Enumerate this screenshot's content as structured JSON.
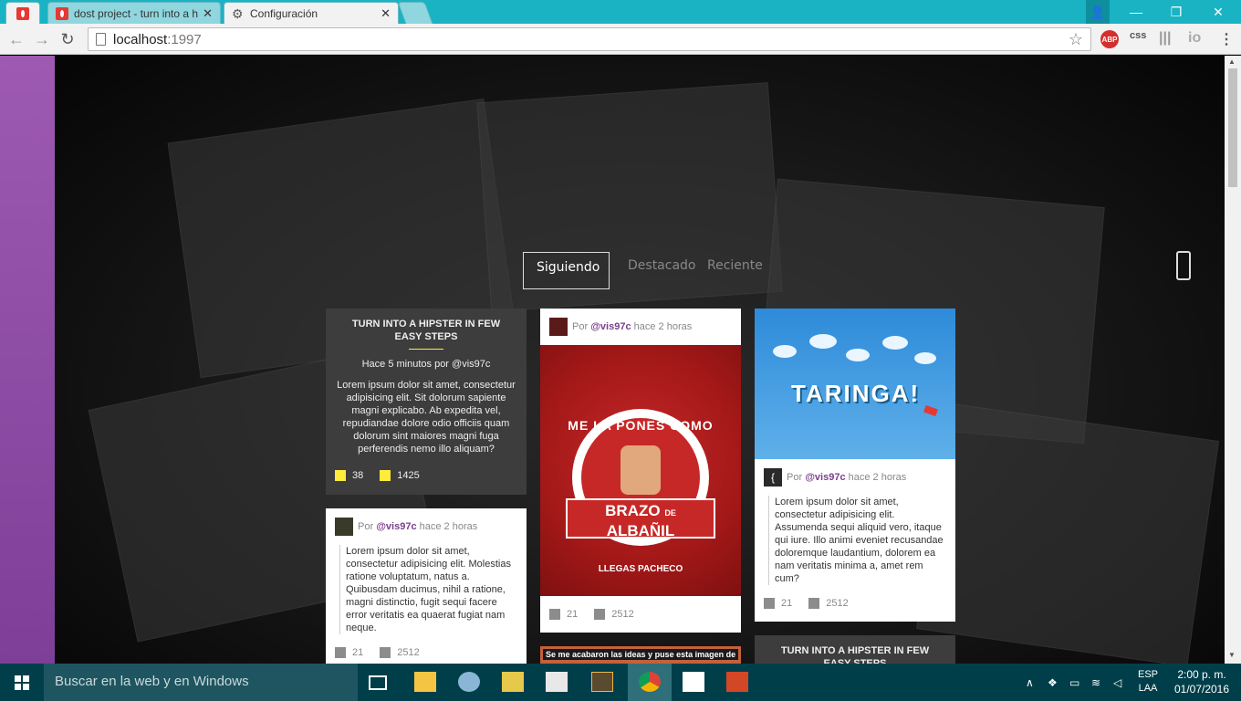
{
  "browser": {
    "tabs": [
      {
        "label": ""
      },
      {
        "label": "dost project - turn into a h"
      },
      {
        "label": "Configuración"
      }
    ],
    "url_host": "localhost",
    "url_port": ":1997",
    "extensions": {
      "abp": "ABP",
      "css": "css",
      "io": "io"
    }
  },
  "feed": {
    "tabs": {
      "following": "Siguiendo",
      "featured": "Destacado",
      "recent": "Reciente"
    },
    "card1": {
      "title": "TURN INTO A HIPSTER IN FEW EASY STEPS",
      "meta": "Hace 5 minutos por @vis97c",
      "body": "Lorem ipsum dolor sit amet, consectetur adipisicing elit. Sit dolorum sapiente magni explicabo. Ab expedita vel, repudiandae dolore odio officiis quam dolorum sint maiores magni fuga perferendis nemo illo aliquam?",
      "stat1": "38",
      "stat2": "1425"
    },
    "card2": {
      "por": "Por",
      "handle": "@vis97c",
      "time": "hace 2 horas",
      "body": "Lorem ipsum dolor sit amet, consectetur adipisicing elit. Molestias ratione voluptatum, natus a. Quibusdam ducimus, nihil a ratione, magni distinctio, fugit sequi facere error veritatis ea quaerat fugiat nam neque.",
      "stat1": "21",
      "stat2": "2512"
    },
    "card3": {
      "por": "Por",
      "handle": "@vis97c",
      "time": "hace 2 horas",
      "poster_top": "ME LA PONES COMO",
      "poster_banner": "BRAZO",
      "poster_de": "DE",
      "poster_banner2": "ALBAÑIL",
      "poster_foot": "LLEGAS PACHECO",
      "stat1": "21",
      "stat2": "2512"
    },
    "card4": {
      "banner_text": "Se me acabaron las ideas y puse esta imagen de relleno"
    },
    "card5": {
      "image_text": "TARINGA!",
      "por": "Por",
      "handle": "@vis97c",
      "time": "hace 2 horas",
      "body": "Lorem ipsum dolor sit amet, consectetur adipisicing elit. Assumenda sequi aliquid vero, itaque qui iure. Illo animi eveniet recusandae doloremque laudantium, dolorem ea nam veritatis minima a, amet rem cum?",
      "stat1": "21",
      "stat2": "2512"
    },
    "card6": {
      "title": "TURN INTO A HIPSTER IN FEW EASY STEPS"
    }
  },
  "taskbar": {
    "search_placeholder": "Buscar en la web y en Windows",
    "lang1": "ESP",
    "lang2": "LAA",
    "time": "2:00 p. m.",
    "date": "01/07/2016"
  },
  "colors": {
    "accent_purple": "#7e3f98",
    "titlebar": "#1ab3c4",
    "taskbar": "#003f4a",
    "stat_yellow": "#ffeb3b"
  }
}
